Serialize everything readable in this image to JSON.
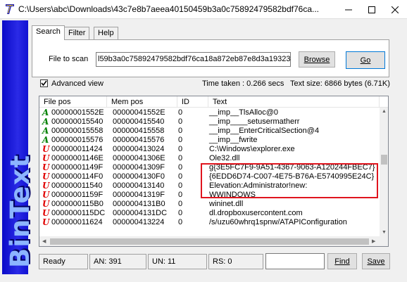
{
  "window": {
    "title": "C:\\Users\\abc\\Downloads\\43c7e8b7aeea40150459b3a0c75892479582bdf76ca...",
    "logo_text": "BinText"
  },
  "tabs": [
    {
      "label": "Search"
    },
    {
      "label": "Filter"
    },
    {
      "label": "Help"
    }
  ],
  "search": {
    "file_label": "File to scan",
    "file_value": "l59b3a0c75892479582bdf76ca18a872eb87e8d3a19323f",
    "browse_label": "Browse",
    "go_label": "Go",
    "advanced_view_label": "Advanced view",
    "advanced_view_checked": true,
    "time_taken": "Time taken : 0.266 secs",
    "text_size": "Text size: 6866 bytes (6.71K)"
  },
  "table": {
    "columns": [
      "File pos",
      "Mem pos",
      "ID",
      "Text"
    ],
    "rows": [
      {
        "type": "A",
        "file_pos": "00000001552E",
        "mem_pos": "00000041552E",
        "id": "0",
        "text": "__imp__TlsAlloc@0"
      },
      {
        "type": "A",
        "file_pos": "000000015540",
        "mem_pos": "000000415540",
        "id": "0",
        "text": "__imp____setusermatherr"
      },
      {
        "type": "A",
        "file_pos": "000000015558",
        "mem_pos": "000000415558",
        "id": "0",
        "text": "__imp__EnterCriticalSection@4"
      },
      {
        "type": "A",
        "file_pos": "000000015576",
        "mem_pos": "000000415576",
        "id": "0",
        "text": "__imp__fwrite"
      },
      {
        "type": "U",
        "file_pos": "000000011424",
        "mem_pos": "000000413024",
        "id": "0",
        "text": "C:\\Windows\\explorer.exe"
      },
      {
        "type": "U",
        "file_pos": "00000001146E",
        "mem_pos": "00000041306E",
        "id": "0",
        "text": "Ole32.dll"
      },
      {
        "type": "U",
        "file_pos": "00000001149F",
        "mem_pos": "00000041309F",
        "id": "0",
        "text": "g{3E5FC7F9-9A51-4367-9063-A120244FBEC7}"
      },
      {
        "type": "U",
        "file_pos": "0000000114F0",
        "mem_pos": "0000004130F0",
        "id": "0",
        "text": "{6EDD6D74-C007-4E75-B76A-E5740995E24C}"
      },
      {
        "type": "U",
        "file_pos": "000000011540",
        "mem_pos": "000000413140",
        "id": "0",
        "text": "Elevation:Administrator!new:"
      },
      {
        "type": "U",
        "file_pos": "00000001159F",
        "mem_pos": "00000041319F",
        "id": "0",
        "text": "WWINDOWS"
      },
      {
        "type": "U",
        "file_pos": "0000000115B0",
        "mem_pos": "0000004131B0",
        "id": "0",
        "text": "wininet.dll"
      },
      {
        "type": "U",
        "file_pos": "0000000115DC",
        "mem_pos": "0000004131DC",
        "id": "0",
        "text": "dl.dropboxusercontent.com"
      },
      {
        "type": "U",
        "file_pos": "000000011624",
        "mem_pos": "000000413224",
        "id": "0",
        "text": "/s/uzu60whrq1spnw/ATAPIConfiguration"
      }
    ]
  },
  "statusbar": {
    "ready": "Ready",
    "an": "AN: 391",
    "un": "UN: 11",
    "rs": "RS: 0",
    "find_label": "Find",
    "save_label": "Save"
  },
  "colors": {
    "ansi_marker": "#008000",
    "unicode_marker": "#e00000",
    "highlight_box": "#e0151e",
    "banner": "#1a1ad8"
  }
}
